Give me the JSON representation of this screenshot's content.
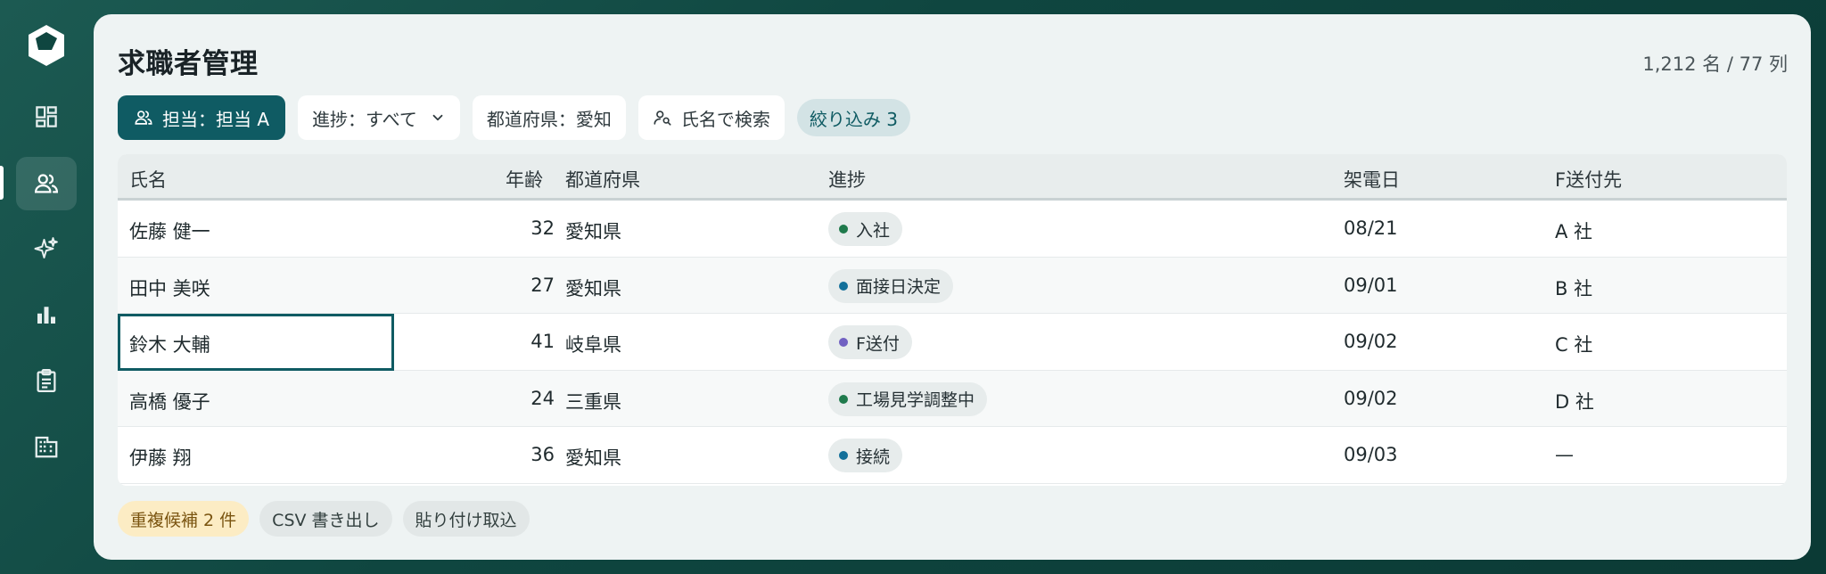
{
  "header": {
    "title": "求職者管理",
    "count": "1,212 名 / 77 列"
  },
  "filters": {
    "owner": "担当：担当 A",
    "progress": "進捗：すべて",
    "prefecture": "都道府県：愛知",
    "search": "氏名で検索",
    "active_count": "絞り込み 3"
  },
  "table": {
    "columns": [
      "氏名",
      "年齢",
      "都道府県",
      "進捗",
      "架電日",
      "F送付先"
    ],
    "rows": [
      {
        "name": "佐藤 健一",
        "age": "32",
        "pref": "愛知県",
        "progress": "入社",
        "progress_color": "#1f7a4c",
        "date": "08/21",
        "dest": "A 社"
      },
      {
        "name": "田中 美咲",
        "age": "27",
        "pref": "愛知県",
        "progress": "面接日決定",
        "progress_color": "#13709a",
        "date": "09/01",
        "dest": "B 社"
      },
      {
        "name": "鈴木 大輔",
        "age": "41",
        "pref": "岐阜県",
        "progress": "F送付",
        "progress_color": "#7161c2",
        "date": "09/02",
        "dest": "C 社"
      },
      {
        "name": "高橋 優子",
        "age": "24",
        "pref": "三重県",
        "progress": "工場見学調整中",
        "progress_color": "#1f7a4c",
        "date": "09/02",
        "dest": "D 社"
      },
      {
        "name": "伊藤 翔",
        "age": "36",
        "pref": "愛知県",
        "progress": "接続",
        "progress_color": "#13709a",
        "date": "09/03",
        "dest": "—"
      }
    ]
  },
  "footer": {
    "duplicates": "重複候補 2 件",
    "csv_export": "CSV 書き出し",
    "paste_import": "貼り付け取込"
  },
  "colors": {
    "accent": "#0f5b63",
    "background": "#0f4640"
  }
}
